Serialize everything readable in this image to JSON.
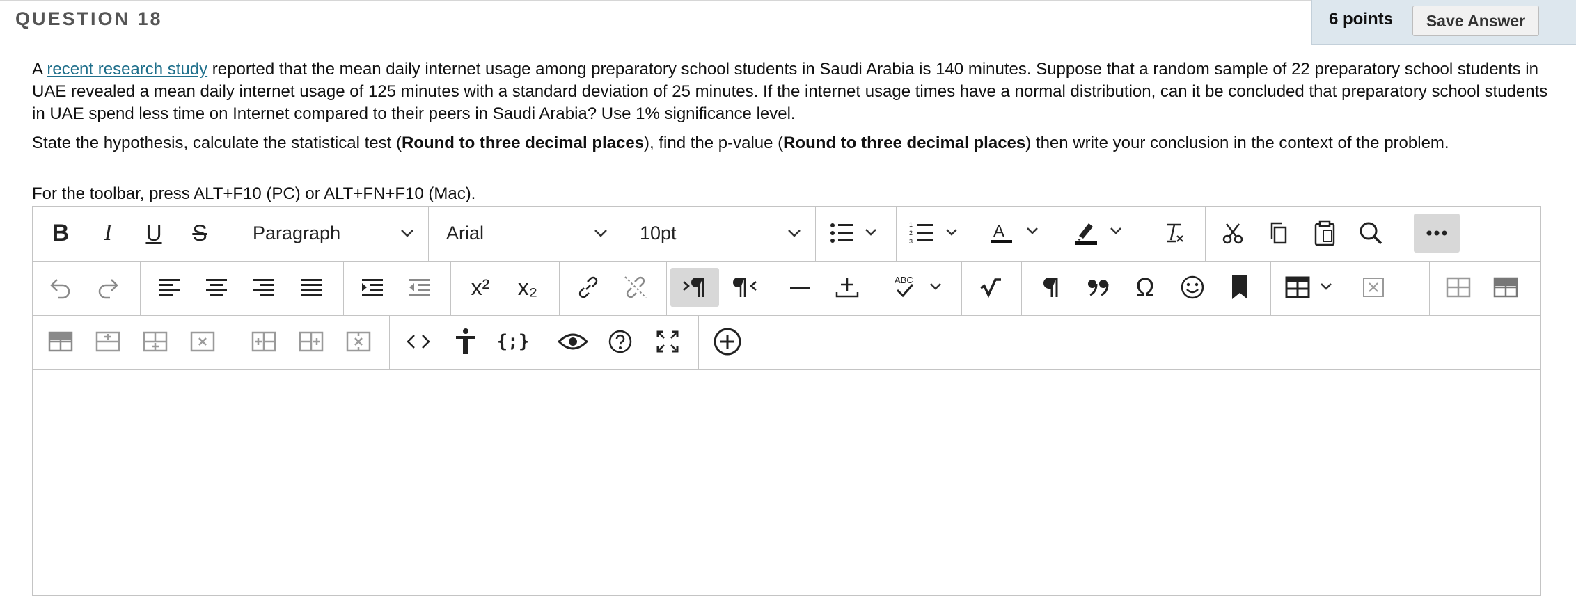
{
  "header": {
    "title": "QUESTION 18",
    "points": "6 points",
    "save_label": "Save Answer"
  },
  "question": {
    "link_text": "recent research study",
    "p1_prefix": "A ",
    "p1_rest": " reported that the mean daily internet usage among preparatory school students in Saudi Arabia is 140 minutes. Suppose that a random sample of 22 preparatory school students in UAE revealed a mean daily internet usage of 125 minutes with a standard deviation of 25 minutes. If the internet usage times have a normal distribution, can it be concluded that preparatory school students in UAE spend less time on Internet compared to their peers in Saudi Arabia? Use 1% significance level.",
    "p2_a": "State the hypothesis, calculate the statistical test (",
    "p2_bold1": "Round to three decimal places",
    "p2_b": "), find the p-value (",
    "p2_bold2": "Round to three decimal places",
    "p2_c": ") then write your conclusion in the context of the problem."
  },
  "hint": "For the toolbar, press ALT+F10 (PC) or ALT+FN+F10 (Mac).",
  "toolbar": {
    "bold": "B",
    "italic": "I",
    "underline": "U",
    "strike": "S",
    "block_format": "Paragraph",
    "font_family": "Arial",
    "font_size": "10pt",
    "superscript": "x²",
    "subscript": "x₂",
    "spellcheck_label": "ABC"
  },
  "icons": [
    "bold-icon",
    "italic-icon",
    "underline-icon",
    "strikethrough-icon",
    "bullet-list-icon",
    "numbered-list-icon",
    "text-color-icon",
    "highlight-icon",
    "clear-formatting-icon",
    "cut-icon",
    "copy-icon",
    "paste-icon",
    "search-icon",
    "more-icon",
    "undo-icon",
    "redo-icon",
    "align-left-icon",
    "align-center-icon",
    "align-right-icon",
    "justify-icon",
    "indent-icon",
    "outdent-icon",
    "superscript-icon",
    "subscript-icon",
    "link-icon",
    "unlink-icon",
    "ltr-icon",
    "rtl-icon",
    "horizontal-line-icon",
    "insert-icon",
    "spellcheck-icon",
    "math-icon",
    "paragraph-mark-icon",
    "blockquote-icon",
    "omega-icon",
    "emoji-icon",
    "bookmark-icon",
    "table-icon",
    "delete-table-icon",
    "table-cell-icon",
    "table-row-icon",
    "html-code-icon",
    "accessibility-icon",
    "code-sample-icon",
    "preview-icon",
    "help-icon",
    "fullscreen-icon",
    "add-content-icon"
  ],
  "colors": {
    "link": "#1f6f8b",
    "points_bg": "#dde7ee",
    "active_btn": "#d8d8d8"
  }
}
